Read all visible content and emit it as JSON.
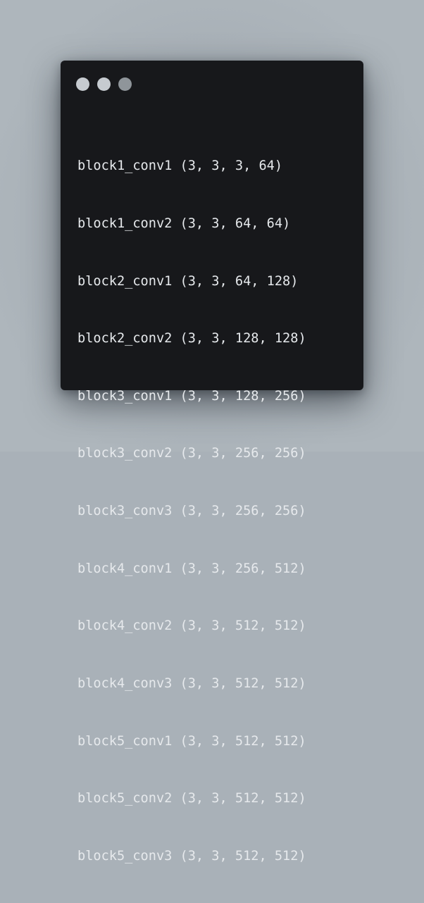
{
  "window": {
    "controls": [
      {
        "name": "window-control-dot-icon",
        "color": "#c6cbd0"
      },
      {
        "name": "window-control-dot-icon",
        "color": "#c6cbd0"
      },
      {
        "name": "window-control-dot-icon",
        "color": "#8f959a"
      }
    ]
  },
  "code": {
    "lines": [
      "block1_conv1 (3, 3, 3, 64)",
      "block1_conv2 (3, 3, 64, 64)",
      "block2_conv1 (3, 3, 64, 128)",
      "block2_conv2 (3, 3, 128, 128)",
      "block3_conv1 (3, 3, 128, 256)",
      "block3_conv2 (3, 3, 256, 256)",
      "block3_conv3 (3, 3, 256, 256)",
      "block4_conv1 (3, 3, 256, 512)",
      "block4_conv2 (3, 3, 512, 512)",
      "block4_conv3 (3, 3, 512, 512)",
      "block5_conv1 (3, 3, 512, 512)",
      "block5_conv2 (3, 3, 512, 512)",
      "block5_conv3 (3, 3, 512, 512)"
    ]
  },
  "colors": {
    "background": "#a9b1b8",
    "window_background": "#17181b",
    "text": "#e6e9ec"
  }
}
